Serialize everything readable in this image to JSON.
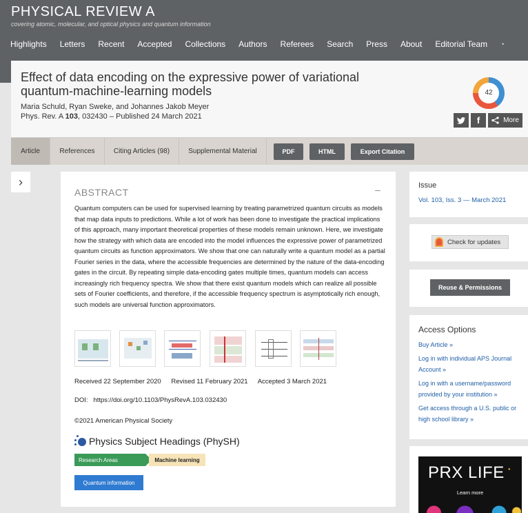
{
  "journal": {
    "name": "PHYSICAL REVIEW A",
    "tagline": "covering atomic, molecular, and optical physics and quantum information"
  },
  "nav": [
    "Highlights",
    "Letters",
    "Recent",
    "Accepted",
    "Collections",
    "Authors",
    "Referees",
    "Search",
    "Press",
    "About",
    "Editorial Team"
  ],
  "article": {
    "title": "Effect of data encoding on the expressive power of variational quantum-machine-learning models",
    "authors": "Maria Schuld, Ryan Sweke, and Johannes Jakob Meyer",
    "citation_prefix": "Phys. Rev. A ",
    "volume": "103",
    "citation_suffix": ", 032430 – Published 24 March 2021",
    "altmetric_score": "42"
  },
  "share": {
    "more_label": "More"
  },
  "tabs": [
    "Article",
    "References",
    "Citing Articles (98)",
    "Supplemental Material"
  ],
  "tab_buttons": [
    "PDF",
    "HTML",
    "Export Citation"
  ],
  "abstract": {
    "heading": "ABSTRACT",
    "collapse": "–",
    "text": "Quantum computers can be used for supervised learning by treating parametrized quantum circuits as models that map data inputs to predictions. While a lot of work has been done to investigate the practical implications of this approach, many important theoretical properties of these models remain unknown. Here, we investigate how the strategy with which data are encoded into the model influences the expressive power of parametrized quantum circuits as function approximators. We show that one can naturally write a quantum model as a partial Fourier series in the data, where the accessible frequencies are determined by the nature of the data-encoding gates in the circuit. By repeating simple data-encoding gates multiple times, quantum models can access increasingly rich frequency spectra. We show that there exist quantum models which can realize all possible sets of Fourier coefficients, and therefore, if the accessible frequency spectrum is asymptotically rich enough, such models are universal function approximators."
  },
  "dates": {
    "received": "Received 22 September 2020",
    "revised": "Revised 11 February 2021",
    "accepted": "Accepted 3 March 2021"
  },
  "doi": "DOI:   https://doi.org/10.1103/PhysRevA.103.032430",
  "copyright": "©2021 American Physical Society",
  "physh": {
    "heading": "Physics Subject Headings (PhySH)",
    "research_areas": "Research Areas",
    "machine_learning": "Machine learning",
    "quantum_information": "Quantum information"
  },
  "sidebar": {
    "issue_heading": "Issue",
    "issue_link": "Vol. 103, Iss. 3 — March 2021",
    "check_updates": "Check for updates",
    "reuse": "Reuse & Permissions",
    "access_heading": "Access Options",
    "access_links": [
      "Buy Article »",
      "Log in with individual APS Journal Account »",
      "Log in with a username/password provided by your institution »",
      "Get access through a U.S. public or high school library »"
    ]
  },
  "ad": {
    "title": "PRX LIFE",
    "cta": "Learn more"
  },
  "colors": {
    "header": "#5f6264",
    "link": "#1f5ea8",
    "research_area": "#3a9a58",
    "topic": "#2f7bd1"
  }
}
